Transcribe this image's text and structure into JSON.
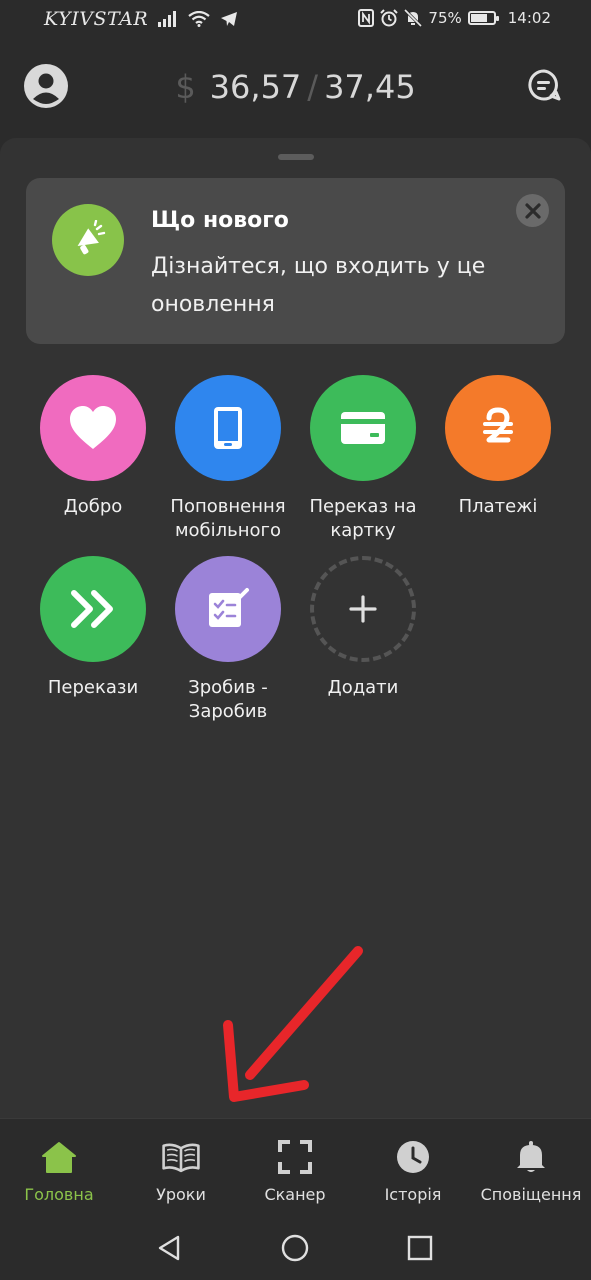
{
  "status_bar": {
    "carrier": "KYIVSTAR",
    "battery": "75%",
    "battery_level": 0.75,
    "time": "14:02"
  },
  "header": {
    "currency": "$",
    "rate_buy": "36,57",
    "separator": "/",
    "rate_sell": "37,45"
  },
  "news_card": {
    "title": "Що нового",
    "text": "Дізнайтеся, що входить у це оновлення"
  },
  "tiles": [
    {
      "label": "Добро",
      "color": "#f06bbf",
      "icon": "heart-icon"
    },
    {
      "label": "Поповнення мобільного",
      "color": "#2f86ee",
      "icon": "phone-icon"
    },
    {
      "label": "Переказ на картку",
      "color": "#3dbb5a",
      "icon": "card-icon"
    },
    {
      "label": "Платежі",
      "color": "#f47a2a",
      "icon": "hryvnia-icon"
    },
    {
      "label": "Перекази",
      "color": "#3dbb5a",
      "icon": "double-chevron-icon"
    },
    {
      "label": "Зробив - Заробив",
      "color": "#9b83d8",
      "icon": "checklist-icon"
    },
    {
      "label": "Додати",
      "icon": "plus-icon"
    }
  ],
  "bottom_nav": [
    {
      "label": "Головна",
      "icon": "home-icon",
      "active": true
    },
    {
      "label": "Уроки",
      "icon": "book-icon"
    },
    {
      "label": "Сканер",
      "icon": "scanner-icon"
    },
    {
      "label": "Історія",
      "icon": "clock-icon"
    },
    {
      "label": "Сповіщення",
      "icon": "bell-icon"
    }
  ],
  "colors": {
    "background": "#2b2b2b",
    "sheet": "#333333",
    "accent_green": "#8bc34a",
    "annotation_arrow": "#e8262a"
  }
}
